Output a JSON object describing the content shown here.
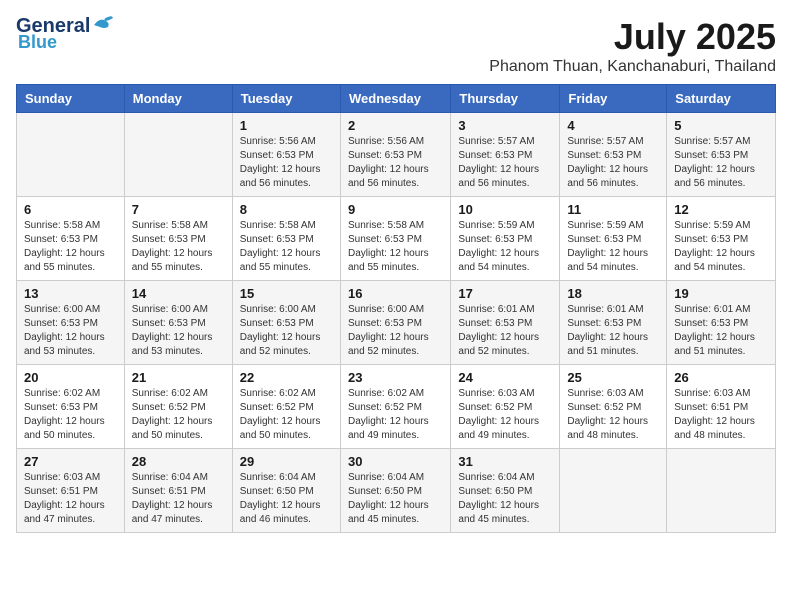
{
  "header": {
    "logo_line1": "General",
    "logo_line2": "Blue",
    "month": "July 2025",
    "location": "Phanom Thuan, Kanchanaburi, Thailand"
  },
  "days_of_week": [
    "Sunday",
    "Monday",
    "Tuesday",
    "Wednesday",
    "Thursday",
    "Friday",
    "Saturday"
  ],
  "weeks": [
    [
      {
        "day": "",
        "info": ""
      },
      {
        "day": "",
        "info": ""
      },
      {
        "day": "1",
        "info": "Sunrise: 5:56 AM\nSunset: 6:53 PM\nDaylight: 12 hours and 56 minutes."
      },
      {
        "day": "2",
        "info": "Sunrise: 5:56 AM\nSunset: 6:53 PM\nDaylight: 12 hours and 56 minutes."
      },
      {
        "day": "3",
        "info": "Sunrise: 5:57 AM\nSunset: 6:53 PM\nDaylight: 12 hours and 56 minutes."
      },
      {
        "day": "4",
        "info": "Sunrise: 5:57 AM\nSunset: 6:53 PM\nDaylight: 12 hours and 56 minutes."
      },
      {
        "day": "5",
        "info": "Sunrise: 5:57 AM\nSunset: 6:53 PM\nDaylight: 12 hours and 56 minutes."
      }
    ],
    [
      {
        "day": "6",
        "info": "Sunrise: 5:58 AM\nSunset: 6:53 PM\nDaylight: 12 hours and 55 minutes."
      },
      {
        "day": "7",
        "info": "Sunrise: 5:58 AM\nSunset: 6:53 PM\nDaylight: 12 hours and 55 minutes."
      },
      {
        "day": "8",
        "info": "Sunrise: 5:58 AM\nSunset: 6:53 PM\nDaylight: 12 hours and 55 minutes."
      },
      {
        "day": "9",
        "info": "Sunrise: 5:58 AM\nSunset: 6:53 PM\nDaylight: 12 hours and 55 minutes."
      },
      {
        "day": "10",
        "info": "Sunrise: 5:59 AM\nSunset: 6:53 PM\nDaylight: 12 hours and 54 minutes."
      },
      {
        "day": "11",
        "info": "Sunrise: 5:59 AM\nSunset: 6:53 PM\nDaylight: 12 hours and 54 minutes."
      },
      {
        "day": "12",
        "info": "Sunrise: 5:59 AM\nSunset: 6:53 PM\nDaylight: 12 hours and 54 minutes."
      }
    ],
    [
      {
        "day": "13",
        "info": "Sunrise: 6:00 AM\nSunset: 6:53 PM\nDaylight: 12 hours and 53 minutes."
      },
      {
        "day": "14",
        "info": "Sunrise: 6:00 AM\nSunset: 6:53 PM\nDaylight: 12 hours and 53 minutes."
      },
      {
        "day": "15",
        "info": "Sunrise: 6:00 AM\nSunset: 6:53 PM\nDaylight: 12 hours and 52 minutes."
      },
      {
        "day": "16",
        "info": "Sunrise: 6:00 AM\nSunset: 6:53 PM\nDaylight: 12 hours and 52 minutes."
      },
      {
        "day": "17",
        "info": "Sunrise: 6:01 AM\nSunset: 6:53 PM\nDaylight: 12 hours and 52 minutes."
      },
      {
        "day": "18",
        "info": "Sunrise: 6:01 AM\nSunset: 6:53 PM\nDaylight: 12 hours and 51 minutes."
      },
      {
        "day": "19",
        "info": "Sunrise: 6:01 AM\nSunset: 6:53 PM\nDaylight: 12 hours and 51 minutes."
      }
    ],
    [
      {
        "day": "20",
        "info": "Sunrise: 6:02 AM\nSunset: 6:53 PM\nDaylight: 12 hours and 50 minutes."
      },
      {
        "day": "21",
        "info": "Sunrise: 6:02 AM\nSunset: 6:52 PM\nDaylight: 12 hours and 50 minutes."
      },
      {
        "day": "22",
        "info": "Sunrise: 6:02 AM\nSunset: 6:52 PM\nDaylight: 12 hours and 50 minutes."
      },
      {
        "day": "23",
        "info": "Sunrise: 6:02 AM\nSunset: 6:52 PM\nDaylight: 12 hours and 49 minutes."
      },
      {
        "day": "24",
        "info": "Sunrise: 6:03 AM\nSunset: 6:52 PM\nDaylight: 12 hours and 49 minutes."
      },
      {
        "day": "25",
        "info": "Sunrise: 6:03 AM\nSunset: 6:52 PM\nDaylight: 12 hours and 48 minutes."
      },
      {
        "day": "26",
        "info": "Sunrise: 6:03 AM\nSunset: 6:51 PM\nDaylight: 12 hours and 48 minutes."
      }
    ],
    [
      {
        "day": "27",
        "info": "Sunrise: 6:03 AM\nSunset: 6:51 PM\nDaylight: 12 hours and 47 minutes."
      },
      {
        "day": "28",
        "info": "Sunrise: 6:04 AM\nSunset: 6:51 PM\nDaylight: 12 hours and 47 minutes."
      },
      {
        "day": "29",
        "info": "Sunrise: 6:04 AM\nSunset: 6:50 PM\nDaylight: 12 hours and 46 minutes."
      },
      {
        "day": "30",
        "info": "Sunrise: 6:04 AM\nSunset: 6:50 PM\nDaylight: 12 hours and 45 minutes."
      },
      {
        "day": "31",
        "info": "Sunrise: 6:04 AM\nSunset: 6:50 PM\nDaylight: 12 hours and 45 minutes."
      },
      {
        "day": "",
        "info": ""
      },
      {
        "day": "",
        "info": ""
      }
    ]
  ]
}
